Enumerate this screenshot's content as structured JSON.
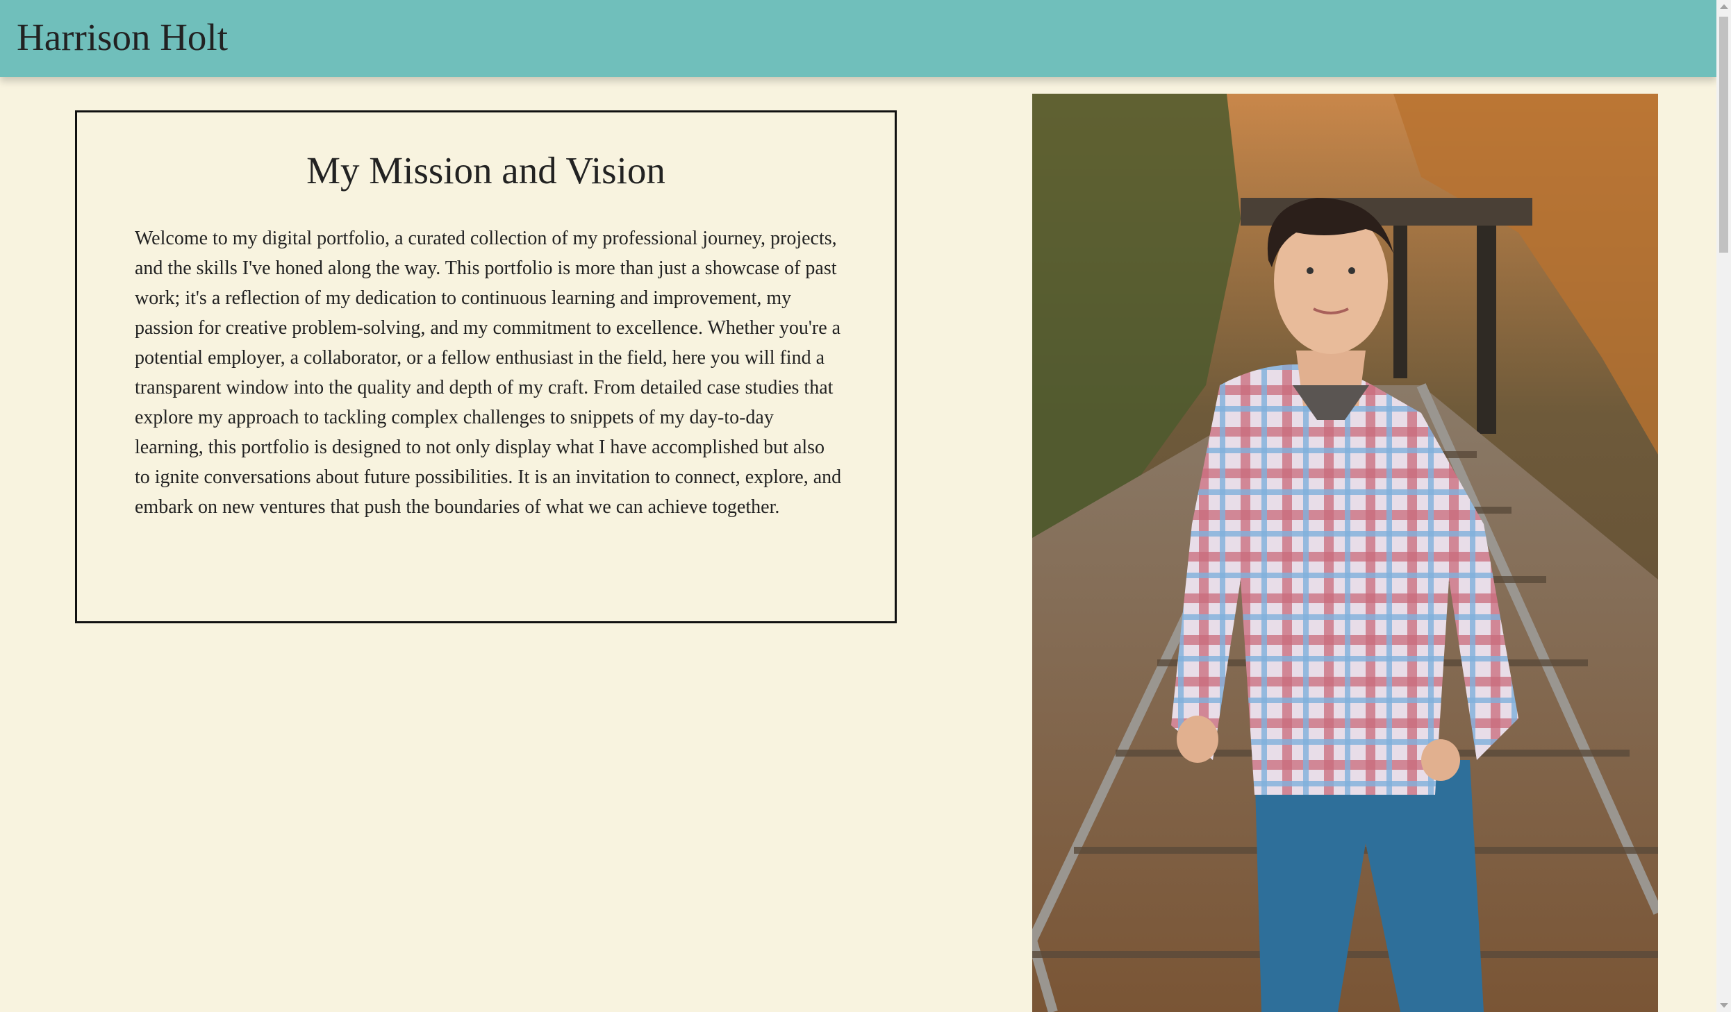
{
  "header": {
    "title": "Harrison Holt"
  },
  "mission": {
    "heading": "My Mission and Vision",
    "body": "Welcome to my digital portfolio, a curated collection of my professional journey, projects, and the skills I've honed along the way. This portfolio is more than just a showcase of past work; it's a reflection of my dedication to continuous learning and improvement, my passion for creative problem-solving, and my commitment to excellence. Whether you're a potential employer, a collaborator, or a fellow enthusiast in the field, here you will find a transparent window into the quality and depth of my craft. From detailed case studies that explore my approach to tackling complex challenges to snippets of my day-to-day learning, this portfolio is designed to not only display what I have accomplished but also to ignite conversations about future possibilities. It is an invitation to connect, explore, and embark on new ventures that push the boundaries of what we can achieve together."
  },
  "colors": {
    "header_bg": "#70bfbb",
    "page_bg": "#f8f3df",
    "text": "#222222"
  }
}
